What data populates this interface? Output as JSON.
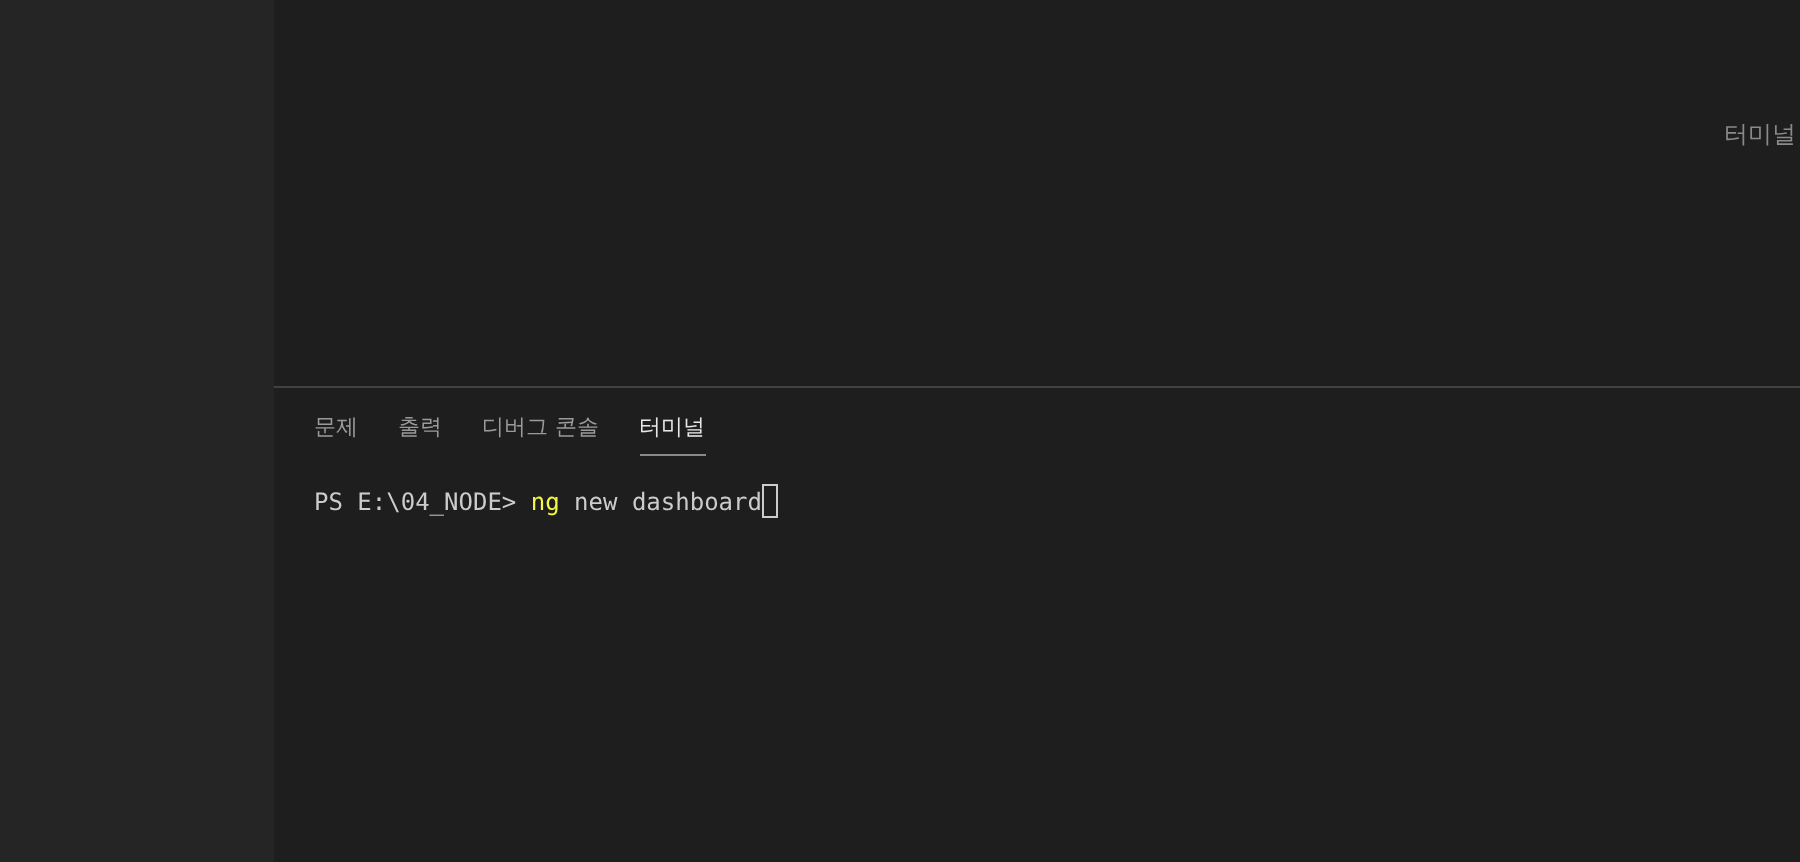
{
  "editor": {
    "hint_text": "터미널"
  },
  "panel": {
    "tabs": [
      {
        "label": "문제",
        "selected": false
      },
      {
        "label": "출력",
        "selected": false
      },
      {
        "label": "디버그 콘솔",
        "selected": false
      },
      {
        "label": "터미널",
        "selected": true
      }
    ],
    "terminal": {
      "segments": [
        {
          "kind": "prompt",
          "text": "PS E:\\04_NODE> "
        },
        {
          "kind": "command",
          "text": "ng"
        },
        {
          "kind": "argument",
          "text": " new dashboard"
        }
      ],
      "cursor": true
    }
  }
}
